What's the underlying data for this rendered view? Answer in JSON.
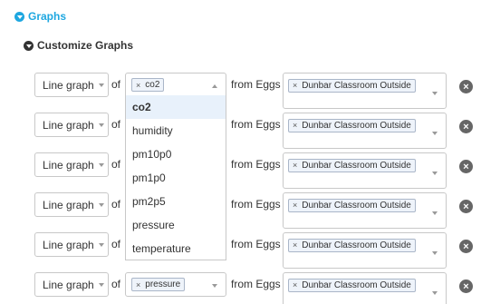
{
  "sections": {
    "graphs": "Graphs",
    "customize": "Customize Graphs"
  },
  "words": {
    "of": "of",
    "from": "from Eggs"
  },
  "rows": [
    {
      "graph_type": "Line graph",
      "metric": "co2",
      "location": "Dunbar Classroom Outside"
    },
    {
      "graph_type": "Line graph",
      "metric": "",
      "location": "Dunbar Classroom Outside"
    },
    {
      "graph_type": "Line graph",
      "metric": "",
      "location": "Dunbar Classroom Outside"
    },
    {
      "graph_type": "Line graph",
      "metric": "",
      "location": "Dunbar Classroom Outside"
    },
    {
      "graph_type": "Line graph",
      "metric": "",
      "location": "Dunbar Classroom Outside"
    },
    {
      "graph_type": "Line graph",
      "metric": "pressure",
      "location": "Dunbar Classroom Outside"
    }
  ],
  "tag_remove": "×",
  "remove_row": "×",
  "dropdown_options": [
    "co2",
    "humidity",
    "pm10p0",
    "pm1p0",
    "pm2p5",
    "pressure",
    "temperature"
  ],
  "colors": {
    "accent": "#1ea7e0",
    "highlight": "#e8f1fb"
  }
}
